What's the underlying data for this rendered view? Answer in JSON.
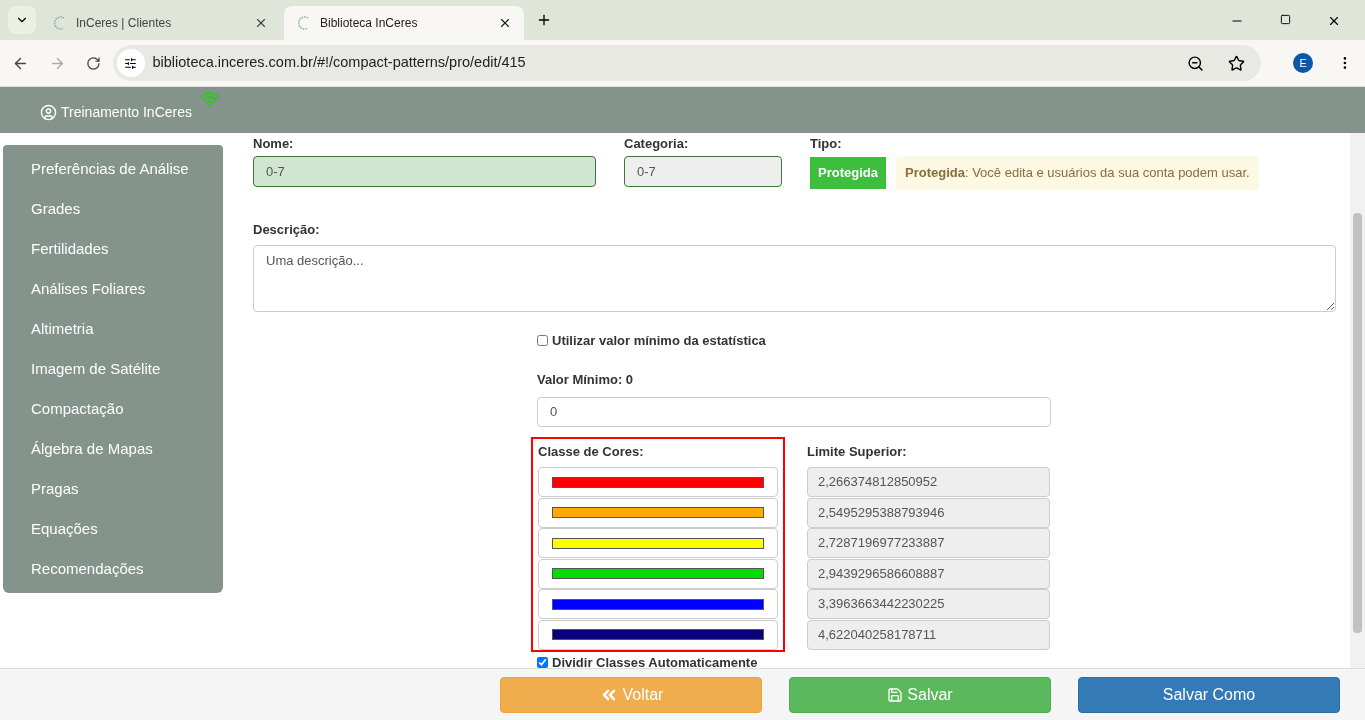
{
  "browser": {
    "tabs": [
      {
        "title": "InCeres | Clientes",
        "selected": false
      },
      {
        "title": "Biblioteca InCeres",
        "selected": true
      }
    ],
    "url": "biblioteca.inceres.com.br/#!/compact-patterns/pro/edit/415",
    "profile": "E"
  },
  "header": {
    "user": "Treinamento InCeres"
  },
  "sidebar": {
    "items": [
      {
        "label": "Preferências de Análise"
      },
      {
        "label": "Grades"
      },
      {
        "label": "Fertilidades"
      },
      {
        "label": "Análises Foliares"
      },
      {
        "label": "Altimetria"
      },
      {
        "label": "Imagem de Satélite"
      },
      {
        "label": "Compactação"
      },
      {
        "label": "Álgebra de Mapas"
      },
      {
        "label": "Pragas"
      },
      {
        "label": "Equações"
      },
      {
        "label": "Recomendações"
      }
    ]
  },
  "form": {
    "name_label": "Nome:",
    "name_value": "0-7",
    "category_label": "Categoria:",
    "category_value": "0-7",
    "type_label": "Tipo:",
    "type_badge": "Protegida",
    "type_note": "**Protegida**: Você edita e usuários da sua conta podem usar.",
    "description_label": "Descrição:",
    "description_placeholder": "Uma descrição...",
    "use_min_stat": {
      "label": "Utilizar valor mínimo da estatística",
      "checked": false
    },
    "min_label": "Valor Mínimo: 0",
    "min_value": "0",
    "colors_label": "Classe de Cores:",
    "limits_label": "Limite Superior:",
    "classes": [
      {
        "color": "#ff0000",
        "limit": "2,266374812850952"
      },
      {
        "color": "#ffaa00",
        "limit": "2,5495295388793946"
      },
      {
        "color": "#ffff00",
        "limit": "2,7287196977233887"
      },
      {
        "color": "#00dd00",
        "limit": "2,9439296586608887"
      },
      {
        "color": "#0000ff",
        "limit": "3,3963663442230225"
      },
      {
        "color": "#0a007a",
        "limit": "4,622040258178711"
      }
    ],
    "auto_split": {
      "label": "Dividir Classes Automaticamente",
      "checked": true
    }
  },
  "footer": {
    "buttons": [
      {
        "label": "Voltar",
        "kind": "back"
      },
      {
        "label": "Salvar",
        "kind": "save"
      },
      {
        "label": "Salvar Como",
        "kind": "save_as"
      }
    ]
  }
}
